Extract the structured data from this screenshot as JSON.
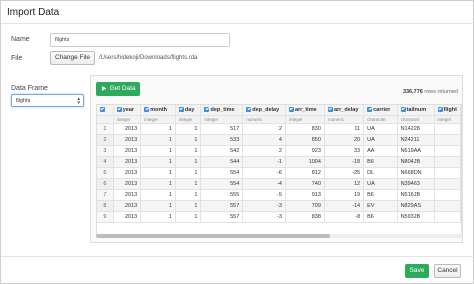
{
  "dialog": {
    "title": "Import Data"
  },
  "form": {
    "name_label": "Name",
    "name_value": "flights",
    "file_label": "File",
    "change_file_label": "Change File",
    "file_path": "/Users/hidekoji/Downloads/flights.rda",
    "data_frame_label": "Data Frame",
    "data_frame_value": "flights"
  },
  "panel": {
    "get_data_label": "Get Data",
    "rows_count": "336,776",
    "rows_suffix": "rows returned"
  },
  "table": {
    "columns": [
      {
        "name": "year",
        "type": "integer"
      },
      {
        "name": "month",
        "type": "integer"
      },
      {
        "name": "day",
        "type": "integer"
      },
      {
        "name": "dep_time",
        "type": "integer"
      },
      {
        "name": "dep_delay",
        "type": "numeric"
      },
      {
        "name": "arr_time",
        "type": "integer"
      },
      {
        "name": "arr_delay",
        "type": "numeric"
      },
      {
        "name": "carrier",
        "type": "character"
      },
      {
        "name": "tailnum",
        "type": "character"
      },
      {
        "name": "flight",
        "type": "integer"
      }
    ],
    "rows": [
      [
        "1",
        "2013",
        "1",
        "1",
        "517",
        "2",
        "830",
        "11",
        "UA",
        "N14228",
        ""
      ],
      [
        "2",
        "2013",
        "1",
        "1",
        "533",
        "4",
        "850",
        "20",
        "UA",
        "N24211",
        ""
      ],
      [
        "3",
        "2013",
        "1",
        "1",
        "542",
        "2",
        "923",
        "33",
        "AA",
        "N619AA",
        ""
      ],
      [
        "4",
        "2013",
        "1",
        "1",
        "544",
        "-1",
        "1004",
        "-18",
        "B6",
        "N804JB",
        ""
      ],
      [
        "5",
        "2013",
        "1",
        "1",
        "554",
        "-6",
        "812",
        "-25",
        "DL",
        "N668DN",
        ""
      ],
      [
        "6",
        "2013",
        "1",
        "1",
        "554",
        "-4",
        "740",
        "12",
        "UA",
        "N39463",
        ""
      ],
      [
        "7",
        "2013",
        "1",
        "1",
        "555",
        "-5",
        "913",
        "19",
        "B6",
        "N516JB",
        ""
      ],
      [
        "8",
        "2013",
        "1",
        "1",
        "557",
        "-3",
        "709",
        "-14",
        "EV",
        "N829AS",
        ""
      ],
      [
        "9",
        "2013",
        "1",
        "1",
        "557",
        "-3",
        "838",
        "-8",
        "B6",
        "N593JB",
        ""
      ]
    ]
  },
  "footer": {
    "save_label": "Save",
    "cancel_label": "Cancel"
  },
  "colors": {
    "accent_green": "#2eaa5c",
    "checkbox_blue": "#3b8ed8"
  }
}
